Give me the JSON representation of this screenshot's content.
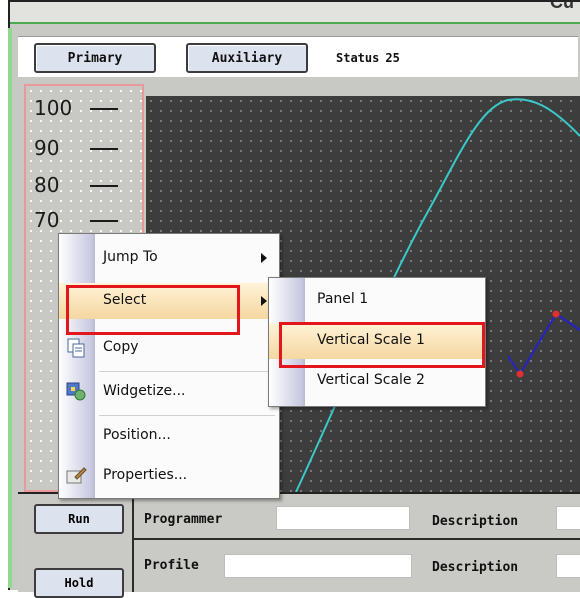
{
  "window": {
    "title_fragment": "Cu"
  },
  "toolbar": {
    "primary_label": "Primary",
    "auxiliary_label": "Auxiliary",
    "status_label": "Status",
    "status_value": "25"
  },
  "scale": {
    "ticks": [
      "100",
      "90",
      "80",
      "70"
    ]
  },
  "context_menu": {
    "items": [
      {
        "label": "Jump To",
        "submenu": true
      },
      {
        "label": "Select",
        "submenu": true,
        "highlighted": true
      },
      {
        "label": "Copy",
        "icon": "copy-icon"
      },
      {
        "label": "Widgetize...",
        "icon": "widgetize-icon"
      },
      {
        "label": "Position..."
      },
      {
        "label": "Properties...",
        "icon": "properties-icon"
      }
    ]
  },
  "submenu": {
    "items": [
      {
        "label": "Panel 1"
      },
      {
        "label": "Vertical Scale 1",
        "highlighted": true
      },
      {
        "label": "Vertical Scale 2"
      }
    ]
  },
  "lower": {
    "run_label": "Run",
    "hold_label": "Hold",
    "programmer_label": "Programmer",
    "profile_label": "Profile",
    "description_label_1": "Description",
    "description_label_2": "Description"
  },
  "colors": {
    "accent_highlight": "#f5d7a0",
    "annotation_red": "#e3161c",
    "trace_cyan": "#3ac8c8",
    "trace_blue": "#2323c8"
  }
}
